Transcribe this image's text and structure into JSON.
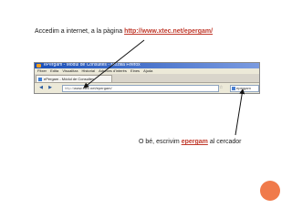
{
  "captions": {
    "top_text": "Accedim a internet, a la pàgina",
    "top_link": "http://www.xtec.net/epergam/",
    "bottom_before": "O bé, escrivim",
    "bottom_highlight": "epergam",
    "bottom_after": "al cercador"
  },
  "browser": {
    "window_title": "ePergam - Mòdul de Consultes - Mozilla Firefox",
    "menu": [
      "Fitxer",
      "Edita",
      "Visualitza",
      "Historial",
      "Adreces d'interès",
      "Eines",
      "Ajuda"
    ],
    "tab_label": "ePergam - Mòdul de Consultes",
    "url_prefix": "http://",
    "url": "www.xtec.net/epergam/",
    "search_value": "epergam",
    "star_glyph": "☆",
    "back_glyph": "◀",
    "forward_glyph": "▶"
  },
  "colors": {
    "accent": "#c0392b",
    "titlebar": "#1a4fb8",
    "decor_dot": "#f07a4a"
  }
}
